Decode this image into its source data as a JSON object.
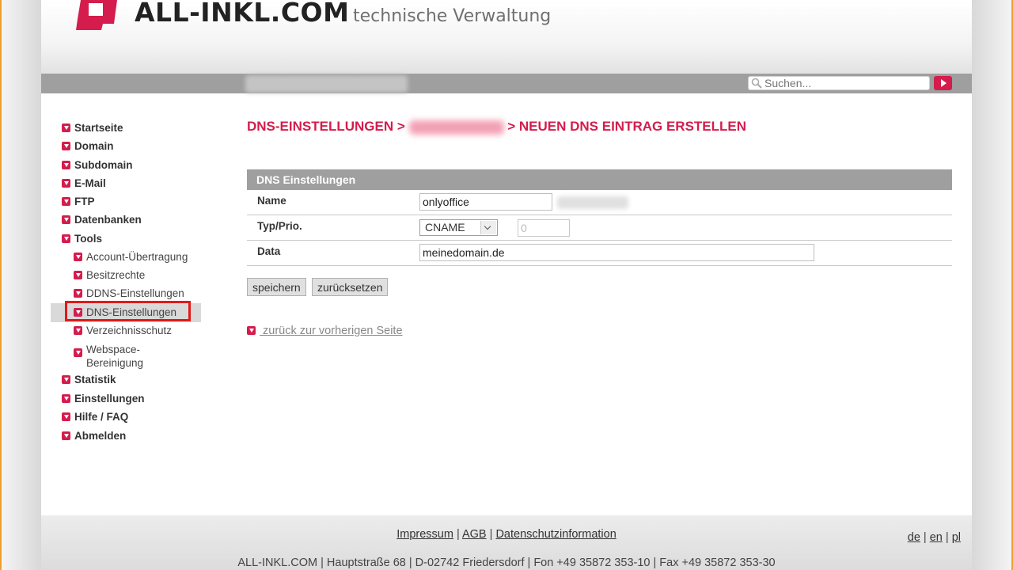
{
  "brand": {
    "name": "ALL-INKL.COM",
    "subtitle": "technische Verwaltung",
    "accent_color": "#d41c4d"
  },
  "topbar": {
    "search_placeholder": "Suchen..."
  },
  "sidebar": {
    "items": [
      {
        "label": "Startseite"
      },
      {
        "label": "Domain"
      },
      {
        "label": "Subdomain"
      },
      {
        "label": "E-Mail"
      },
      {
        "label": "FTP"
      },
      {
        "label": "Datenbanken"
      },
      {
        "label": "Tools"
      }
    ],
    "tools_sub": [
      {
        "label": "Account-Übertragung"
      },
      {
        "label": "Besitzrechte"
      },
      {
        "label": "DDNS-Einstellungen"
      },
      {
        "label": "DNS-Einstellungen",
        "active": true
      },
      {
        "label": "Verzeichnisschutz"
      },
      {
        "label": "Webspace-"
      },
      {
        "label": "Bereinigung"
      }
    ],
    "items_after": [
      {
        "label": "Statistik"
      },
      {
        "label": "Einstellungen"
      },
      {
        "label": "Hilfe / FAQ"
      },
      {
        "label": "Abmelden"
      }
    ]
  },
  "main": {
    "breadcrumb_part1": "DNS-EINSTELLUNGEN >",
    "breadcrumb_part2": "> NEUEN DNS EINTRAG ERSTELLEN",
    "table_title": "DNS Einstellungen",
    "fields": {
      "name_label": "Name",
      "name_value": "onlyoffice",
      "type_label": "Typ/Prio.",
      "type_value": "CNAME",
      "prio_value": "0",
      "data_label": "Data",
      "data_value": "meinedomain.de"
    },
    "save_label": "speichern",
    "reset_label": "zurücksetzen",
    "back_link": " zurück zur vorherigen Seite"
  },
  "footer": {
    "links": [
      "Impressum",
      "AGB",
      "Datenschutzinformation"
    ],
    "languages": [
      "de",
      "en",
      "pl"
    ],
    "address": "ALL-INKL.COM | Hauptstraße 68 | D-02742 Friedersdorf | Fon +49 35872 353-10 | Fax +49 35872 353-30"
  }
}
